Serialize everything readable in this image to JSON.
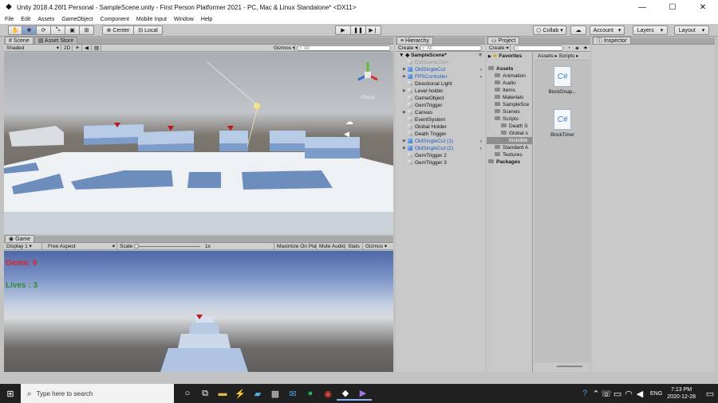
{
  "window": {
    "title": "Unity 2018.4.26f1 Personal - SampleScene.unity - First Person Platformer 2021 - PC, Mac & Linux Standalone* <DX11>"
  },
  "menu": [
    "File",
    "Edit",
    "Assets",
    "GameObject",
    "Component",
    "Mobile Input",
    "Window",
    "Help"
  ],
  "toolbar": {
    "center": "Center",
    "local": "Local",
    "collab": "Collab",
    "account": "Account",
    "layers": "Layers",
    "layout": "Layout"
  },
  "scene": {
    "tabs": [
      "Scene",
      "Asset Store"
    ],
    "shading": "Shaded",
    "mode2d": "2D",
    "gizmos": "Gizmos",
    "search_placeholder": "All",
    "persp": "Persp"
  },
  "game": {
    "tab": "Game",
    "display": "Display 1",
    "aspect": "Free Aspect",
    "scale_label": "Scale",
    "scale_value": "1x",
    "maximize": "Maximize On Play",
    "mute": "Mute Audio",
    "stats": "Stats",
    "gizmos": "Gizmos",
    "gems": "Gems: 0",
    "lives": "Lives : 3"
  },
  "hierarchy": {
    "tab": "Hierarchy",
    "create": "Create",
    "search_placeholder": "All",
    "scene": "SampleScene*",
    "items": [
      {
        "label": "CutSceneCam",
        "color": "#9a9a9a"
      },
      {
        "label": "OldSingleCut",
        "color": "#1f5fbf"
      },
      {
        "label": "FPSController",
        "color": "#1f5fbf"
      },
      {
        "label": "Directional Light",
        "color": "#111111"
      },
      {
        "label": "Level holder",
        "color": "#111111"
      },
      {
        "label": "GameObject",
        "color": "#111111"
      },
      {
        "label": "GemTrigger",
        "color": "#111111"
      },
      {
        "label": "Canvas",
        "color": "#111111"
      },
      {
        "label": "EventSystem",
        "color": "#111111"
      },
      {
        "label": "Global Holder",
        "color": "#111111"
      },
      {
        "label": "Death Trigger",
        "color": "#111111"
      },
      {
        "label": "OldSingleCut (1)",
        "color": "#1f5fbf"
      },
      {
        "label": "OldSingleCut (2)",
        "color": "#1f5fbf"
      },
      {
        "label": "GemTrigger 2",
        "color": "#111111"
      },
      {
        "label": "GemTrigger 3",
        "color": "#111111"
      }
    ]
  },
  "project": {
    "tab": "Project",
    "create": "Create",
    "favorites": "Favorites",
    "breadcrumb": [
      "Assets",
      "Scripts"
    ],
    "tree": [
      {
        "label": "Assets",
        "bold": true,
        "indent": 0
      },
      {
        "label": "Animation",
        "indent": 1
      },
      {
        "label": "Audio",
        "indent": 1
      },
      {
        "label": "Items",
        "indent": 1
      },
      {
        "label": "Materials",
        "indent": 1
      },
      {
        "label": "SampleSce",
        "indent": 1
      },
      {
        "label": "Scenes",
        "indent": 1
      },
      {
        "label": "Scripts",
        "indent": 1
      },
      {
        "label": "Death S",
        "indent": 2
      },
      {
        "label": "Global s",
        "indent": 2
      },
      {
        "label": "Invisible",
        "indent": 2,
        "selected": true
      },
      {
        "label": "Standard A",
        "indent": 1
      },
      {
        "label": "Textures",
        "indent": 1
      },
      {
        "label": "Packages",
        "bold": true,
        "indent": 0
      }
    ],
    "files": [
      "BlockDisap...",
      "BlockTimer"
    ]
  },
  "inspector": {
    "tab": "Inspector"
  },
  "taskbar": {
    "search_placeholder": "Type here to search",
    "lang": "ENG",
    "time": "7:13 PM",
    "date": "2020-12-28"
  }
}
